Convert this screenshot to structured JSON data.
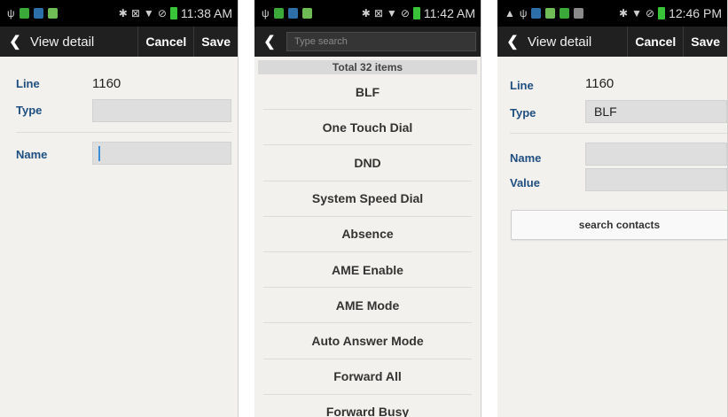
{
  "screen1": {
    "status": {
      "time": "11:38 AM"
    },
    "header": {
      "title": "View detail",
      "cancel": "Cancel",
      "save": "Save"
    },
    "form": {
      "line_label": "Line",
      "line_value": "1160",
      "type_label": "Type",
      "type_value": "",
      "name_label": "Name",
      "name_value": ""
    }
  },
  "screen2": {
    "status": {
      "time": "11:42 AM"
    },
    "search": {
      "placeholder": "Type search"
    },
    "total": "Total 32 items",
    "items": [
      "BLF",
      "One Touch Dial",
      "DND",
      "System Speed Dial",
      "Absence",
      "AME Enable",
      "AME Mode",
      "Auto Answer Mode",
      "Forward All",
      "Forward Busy"
    ]
  },
  "screen3": {
    "status": {
      "time": "12:46 PM"
    },
    "header": {
      "title": "View detail",
      "cancel": "Cancel",
      "save": "Save"
    },
    "form": {
      "line_label": "Line",
      "line_value": "1160",
      "type_label": "Type",
      "type_value": "BLF",
      "name_label": "Name",
      "name_value": "",
      "value_label": "Value",
      "value_value": ""
    },
    "search_contacts": "search contacts"
  },
  "colors": {
    "label_blue": "#1f4f80",
    "actionbar": "#202020",
    "statusbar": "#000000",
    "background": "#f2f1ed",
    "cursor": "#3b8fd9"
  }
}
